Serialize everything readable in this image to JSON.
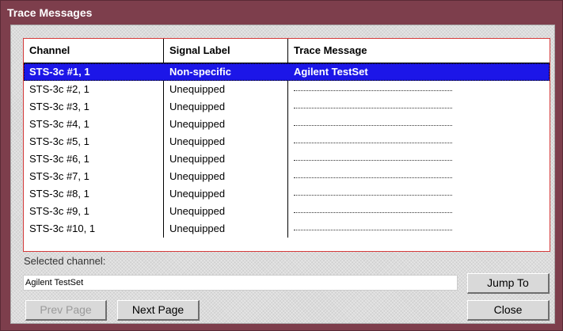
{
  "window": {
    "title": "Trace Messages"
  },
  "table": {
    "columns": [
      "Channel",
      "Signal Label",
      "Trace Message"
    ],
    "rows": [
      {
        "channel": "STS-3c #1, 1",
        "signal_label": "Non-specific",
        "trace_message": "Agilent TestSet",
        "selected": true
      },
      {
        "channel": "STS-3c #2, 1",
        "signal_label": "Unequipped",
        "trace_message": "",
        "selected": false
      },
      {
        "channel": "STS-3c #3, 1",
        "signal_label": "Unequipped",
        "trace_message": "",
        "selected": false
      },
      {
        "channel": "STS-3c #4, 1",
        "signal_label": "Unequipped",
        "trace_message": "",
        "selected": false
      },
      {
        "channel": "STS-3c #5, 1",
        "signal_label": "Unequipped",
        "trace_message": "",
        "selected": false
      },
      {
        "channel": "STS-3c #6, 1",
        "signal_label": "Unequipped",
        "trace_message": "",
        "selected": false
      },
      {
        "channel": "STS-3c #7, 1",
        "signal_label": "Unequipped",
        "trace_message": "",
        "selected": false
      },
      {
        "channel": "STS-3c #8, 1",
        "signal_label": "Unequipped",
        "trace_message": "",
        "selected": false
      },
      {
        "channel": "STS-3c #9, 1",
        "signal_label": "Unequipped",
        "trace_message": "",
        "selected": false
      },
      {
        "channel": "STS-3c #10, 1",
        "signal_label": "Unequipped",
        "trace_message": "",
        "selected": false
      }
    ]
  },
  "selected_channel": {
    "label": "Selected channel:",
    "value": "Agilent TestSet"
  },
  "buttons": {
    "jump_to": "Jump To",
    "prev_page": "Prev Page",
    "next_page": "Next Page",
    "close": "Close"
  },
  "colors": {
    "titlebar": "#7d3e4c",
    "selection": "#1c16e8",
    "table_border": "#d43a3a"
  }
}
